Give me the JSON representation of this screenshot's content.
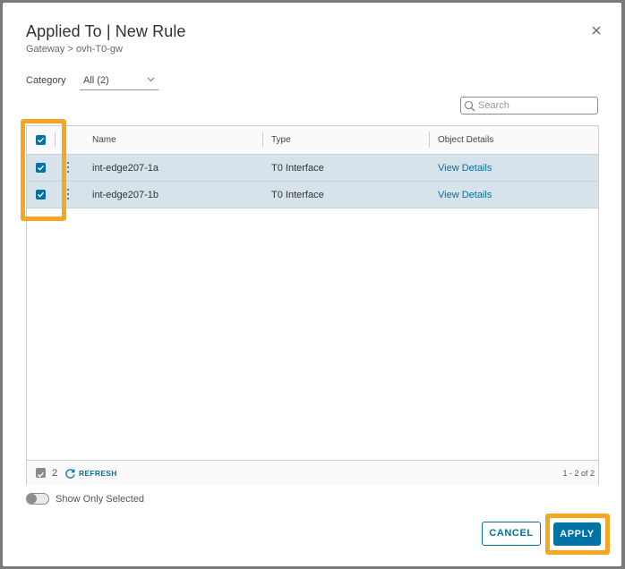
{
  "dialog": {
    "title": "Applied To | New Rule",
    "breadcrumb": "Gateway > ovh-T0-gw"
  },
  "filters": {
    "category_label": "Category",
    "category_value": "All (2)",
    "search_placeholder": "Search"
  },
  "grid": {
    "columns": [
      "Name",
      "Type",
      "Object Details"
    ],
    "rows": [
      {
        "name": "int-edge207-1a",
        "type": "T0 Interface",
        "details": "View Details",
        "selected": true
      },
      {
        "name": "int-edge207-1b",
        "type": "T0 Interface",
        "details": "View Details",
        "selected": true
      }
    ],
    "footer": {
      "selected_count": "2",
      "refresh_label": "REFRESH",
      "pagination": "1 - 2 of 2"
    }
  },
  "toggle": {
    "label": "Show Only Selected",
    "on": false
  },
  "buttons": {
    "cancel": "CANCEL",
    "apply": "APPLY"
  },
  "colors": {
    "accent": "#0072a3",
    "highlight": "#f5a623",
    "selected_row": "#d7e3ea"
  }
}
